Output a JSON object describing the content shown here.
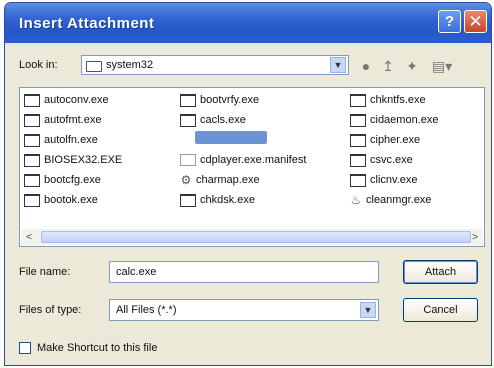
{
  "dialog": {
    "title": "Insert Attachment",
    "help_glyph": "?",
    "close_glyph": "✕"
  },
  "look_in": {
    "label": "Look in:",
    "value": "system32",
    "dropdown_glyph": "▼"
  },
  "toolbar": {
    "back_icon": "back-icon",
    "up_icon": "up-folder-icon",
    "new_folder_icon": "new-folder-icon",
    "views_icon": "views-menu-icon"
  },
  "files": {
    "column1": [
      "autoconv.exe",
      "autofmt.exe",
      "autolfn.exe",
      "BIOSEX32.EXE",
      "bootcfg.exe",
      "bootok.exe"
    ],
    "column2": [
      "bootvrfy.exe",
      "cacls.exe",
      "",
      "cdplayer.exe.manifest",
      "charmap.exe",
      "chkdsk.exe"
    ],
    "column3": [
      "chkntfs.exe",
      "cidaemon.exe",
      "cipher.exe",
      "csvc.exe",
      "clicnv.exe",
      "cleanmgr.exe"
    ]
  },
  "scrollbar": {
    "left_arrow": "<",
    "right_arrow": ">"
  },
  "file_name": {
    "label": "File name:",
    "value": "calc.exe"
  },
  "files_of_type": {
    "label": "Files of type:",
    "value": "All Files (*.*)",
    "dropdown_glyph": "▼"
  },
  "buttons": {
    "attach": "Attach",
    "cancel": "Cancel"
  },
  "shortcut_option": {
    "label": "Make Shortcut to this file",
    "checked": false
  }
}
